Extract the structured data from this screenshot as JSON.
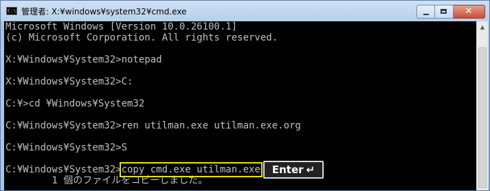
{
  "window": {
    "title": "管理者: X:¥windows¥system32¥cmd.exe",
    "icon_text": "C:\\",
    "buttons": {
      "minimize": "minimize-icon",
      "maximize": "maximize-icon",
      "close_glyph": "✕"
    }
  },
  "console": {
    "lines": [
      "Microsoft Windows [Version 10.0.26100.1]",
      "(c) Microsoft Corporation. All rights reserved.",
      "",
      "X:¥Windows¥System32>notepad",
      "",
      "X:¥Windows¥System32>C:",
      "",
      "C:¥>cd ¥Windows¥System32",
      "",
      "C:¥Windows¥System32>ren utilman.exe utilman.exe.org",
      "",
      "C:¥Windows¥System32>S",
      "",
      "C:¥Windows¥System32>",
      "        1 個のファイルをコピーしました。"
    ],
    "highlighted_command": "copy cmd.exe utilman.exe",
    "highlight_color": "#e8e400",
    "enter_key": {
      "label": "Enter",
      "arrow": "↵"
    }
  },
  "scrollbar": {
    "up_arrow": "▲"
  },
  "colors": {
    "console_background": "#000000",
    "console_text": "#c0c0c0",
    "titlebar": "#b7cfeb",
    "close_button": "#c74f38"
  }
}
